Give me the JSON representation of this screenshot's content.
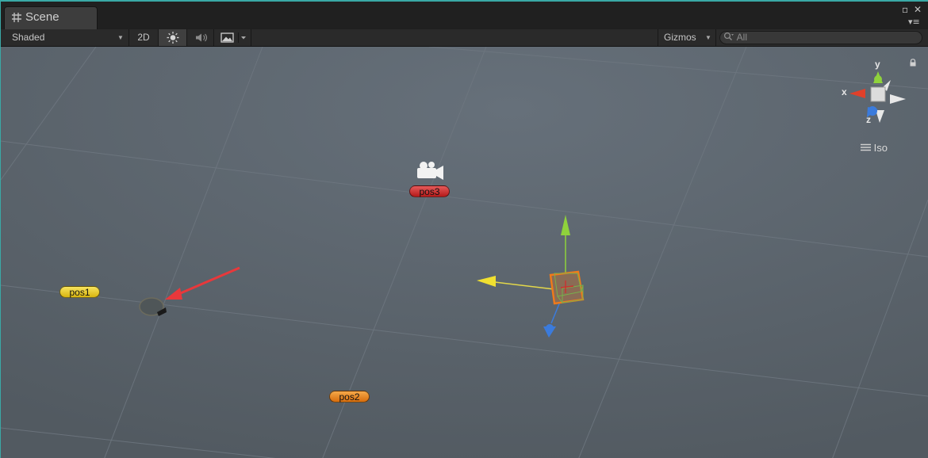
{
  "window": {
    "tab_title": "Scene",
    "tab_icon": "scene-grid-icon",
    "maximize_glyph": "▫",
    "close_glyph": "✕",
    "menu_glyph": "▾≡"
  },
  "toolbar": {
    "draw_mode": "Shaded",
    "mode_2d": "2D",
    "lighting_icon": "sun-icon",
    "audio_icon": "speaker-icon",
    "effects_icon": "image-icon",
    "gizmos_label": "Gizmos",
    "search_placeholder": "All"
  },
  "orientation_gizmo": {
    "x_label": "x",
    "y_label": "y",
    "z_label": "z",
    "projection_label": "Iso",
    "colors": {
      "x": "#e0402a",
      "y": "#8fd23c",
      "z": "#3b7bdc"
    }
  },
  "scene_labels": {
    "pos1": "pos1",
    "pos2": "pos2",
    "pos3": "pos3"
  },
  "colors": {
    "viewport_bg": "#5b636b",
    "accent": "#3aa9a6",
    "annotation_arrow": "#e8383b",
    "selection_outline": "#f07a1a"
  }
}
